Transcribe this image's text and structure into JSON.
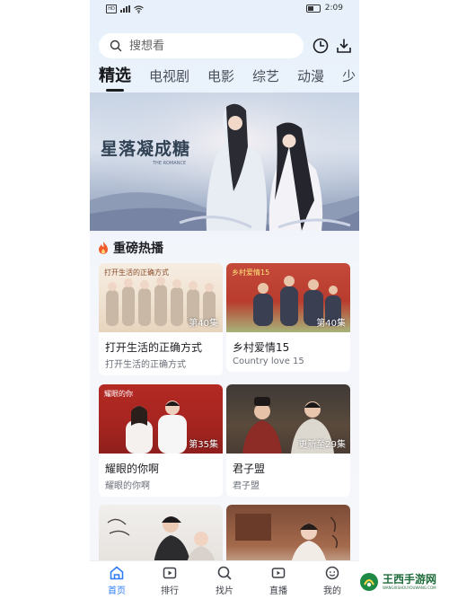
{
  "status_bar": {
    "time": "2:09",
    "sim_label": "HD",
    "icons": [
      "sim-icon",
      "signal-icon",
      "wifi-icon",
      "battery-icon"
    ]
  },
  "search": {
    "placeholder": "搜想看",
    "icons": [
      "search-icon",
      "history-icon",
      "download-icon"
    ]
  },
  "tabs": [
    {
      "label": "精选",
      "active": true
    },
    {
      "label": "电视剧",
      "active": false
    },
    {
      "label": "电影",
      "active": false
    },
    {
      "label": "综艺",
      "active": false
    },
    {
      "label": "动漫",
      "active": false
    },
    {
      "label": "少",
      "active": false
    }
  ],
  "banner": {
    "title": "星落凝成糖",
    "subtitle": "THE ROMANCE"
  },
  "section": {
    "title": "重磅热播",
    "icon": "fire-icon"
  },
  "cards": [
    {
      "name": "打开生活的正确方式",
      "desc": "打开生活的正确方式",
      "badge": "第40集",
      "poster_text": "打开生活的正确方式"
    },
    {
      "name": "乡村爱情15",
      "desc": "Country love 15",
      "badge": "第40集",
      "poster_text": "乡村爱情15"
    },
    {
      "name": "耀眼的你啊",
      "desc": "耀眼的你啊",
      "badge": "第35集",
      "poster_text": "耀眼的你"
    },
    {
      "name": "君子盟",
      "desc": "君子盟",
      "badge": "更新至29集",
      "poster_text": ""
    },
    {
      "name": "",
      "desc": "",
      "badge": "",
      "poster_text": ""
    },
    {
      "name": "",
      "desc": "",
      "badge": "",
      "poster_text": ""
    }
  ],
  "bottom_nav": [
    {
      "label": "首页",
      "icon": "home-icon",
      "active": true
    },
    {
      "label": "排行",
      "icon": "ranking-icon",
      "active": false
    },
    {
      "label": "找片",
      "icon": "find-icon",
      "active": false
    },
    {
      "label": "直播",
      "icon": "live-icon",
      "active": false
    },
    {
      "label": "我的",
      "icon": "profile-icon",
      "active": false
    }
  ],
  "watermark": {
    "text": "王西手游网",
    "sub": "WANGXISHOUYOUWANG.COM"
  },
  "colors": {
    "accent": "#2f7cf6",
    "tab_active": "#15161a",
    "fire": "#f15a2b"
  }
}
